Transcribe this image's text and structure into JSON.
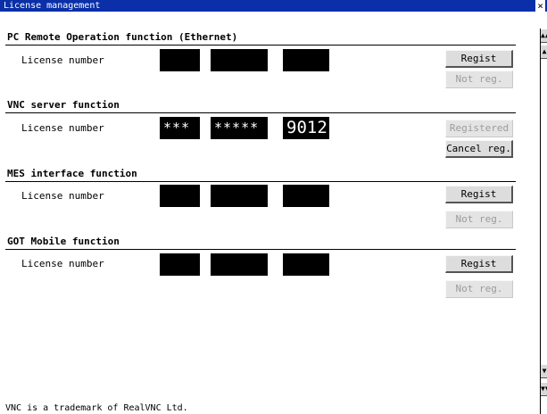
{
  "window": {
    "title": "License management",
    "close_glyph": "×"
  },
  "sections": [
    {
      "heading": "PC Remote Operation function (Ethernet)",
      "license_label": "License number",
      "fields": [
        "",
        "",
        ""
      ],
      "buttons": {
        "primary": "Regist",
        "secondary": "Not reg."
      }
    },
    {
      "heading": "VNC server function",
      "license_label": "License number",
      "fields": [
        "***",
        "*****",
        "9012"
      ],
      "buttons": {
        "primary": "Registered",
        "secondary": "Cancel reg."
      }
    },
    {
      "heading": "MES interface function",
      "license_label": "License number",
      "fields": [
        "",
        "",
        ""
      ],
      "buttons": {
        "primary": "Regist",
        "secondary": "Not reg."
      }
    },
    {
      "heading": "GOT Mobile function",
      "license_label": "License number",
      "fields": [
        "",
        "",
        ""
      ],
      "buttons": {
        "primary": "Regist",
        "secondary": "Not reg."
      }
    }
  ],
  "footer": {
    "trademark": "VNC is a trademark of RealVNC Ltd."
  },
  "scrollbar": {
    "top_icon": "double-up-arrow-icon",
    "up_icon": "up-arrow-icon",
    "down_icon": "down-arrow-icon",
    "bottom_icon": "double-down-arrow-icon"
  }
}
